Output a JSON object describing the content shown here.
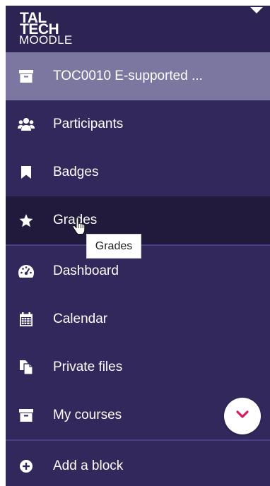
{
  "logo": {
    "line1": "TAL",
    "line2": "TECH",
    "line3": "MOODLE"
  },
  "nav": {
    "course": {
      "label": "TOC0010 E-supported ...",
      "icon": "archive-icon"
    },
    "participants": {
      "label": "Participants",
      "icon": "users-icon"
    },
    "badges": {
      "label": "Badges",
      "icon": "bookmark-icon"
    },
    "grades": {
      "label": "Grades",
      "icon": "star-icon"
    },
    "dashboard": {
      "label": "Dashboard",
      "icon": "dashboard-gauge-icon"
    },
    "calendar": {
      "label": "Calendar",
      "icon": "calendar-icon"
    },
    "private_files": {
      "label": "Private files",
      "icon": "files-icon"
    },
    "my_courses": {
      "label": "My courses",
      "icon": "archive-icon"
    },
    "add_block": {
      "label": "Add a block",
      "icon": "plus-circle-icon"
    }
  },
  "tooltip": {
    "text": "Grades"
  },
  "colors": {
    "drawer_bg": "#33285c",
    "active_bg": "#7b77a0",
    "hover_bg": "#211a3c",
    "divider": "#4b3f85",
    "accent_pink": "#d81b60"
  }
}
